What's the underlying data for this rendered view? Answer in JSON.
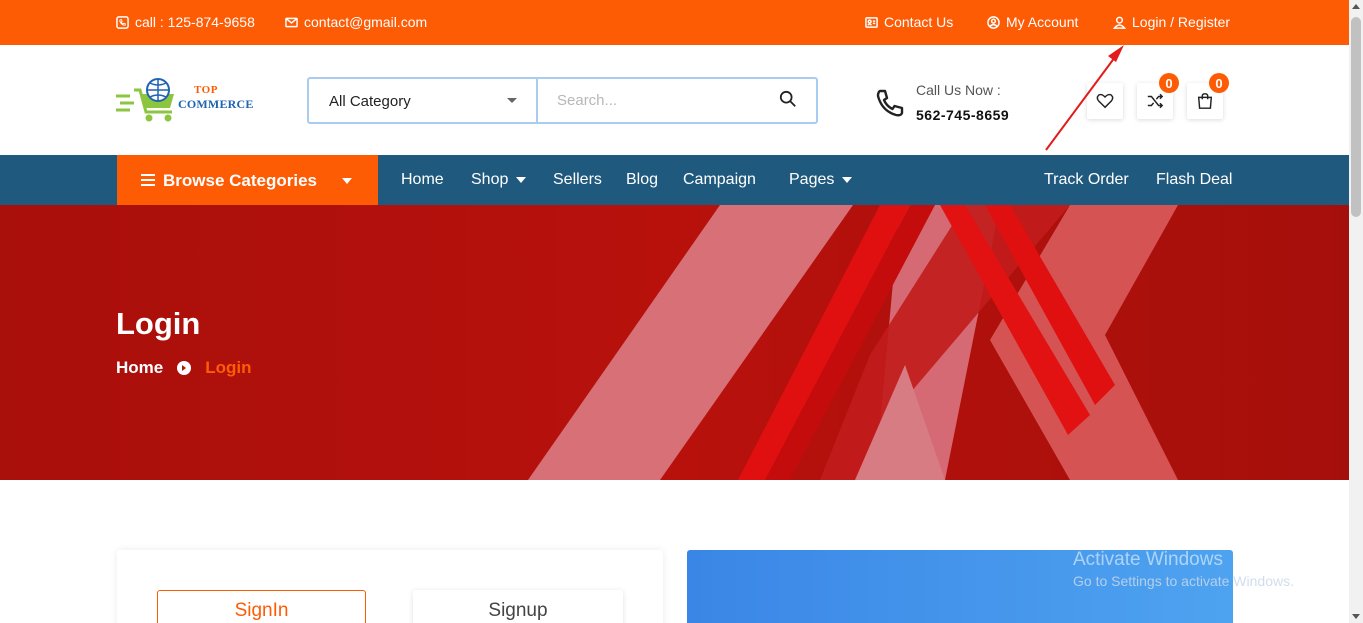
{
  "topbar": {
    "phone_icon": "phone-icon",
    "phone": "call : 125-874-9658",
    "email_icon": "envelope-icon",
    "email": "contact@gmail.com",
    "contact_us": "Contact Us",
    "my_account": "My Account",
    "login_register": "Login / Register"
  },
  "header": {
    "logo_top": "TOP",
    "logo_bottom": "COMMERCE",
    "category_selected": "All Category",
    "search_placeholder": "Search...",
    "call_label": "Call Us Now :",
    "call_number": "562-745-8659",
    "compare_count": "0",
    "cart_count": "0"
  },
  "nav": {
    "browse": "Browse Categories",
    "links": [
      "Home",
      "Shop",
      "Sellers",
      "Blog",
      "Campaign",
      "Pages"
    ],
    "track_order": "Track Order",
    "flash_deal": "Flash Deal"
  },
  "banner": {
    "title": "Login",
    "crumb_home": "Home",
    "crumb_current": "Login"
  },
  "auth": {
    "signin": "SignIn",
    "signup": "Signup"
  },
  "watermark": {
    "line1": "Activate Windows",
    "line2": "Go to Settings to activate Windows."
  },
  "colors": {
    "accent": "#fe5b05",
    "nav": "#1f5a7e",
    "banner": "#b3110c",
    "annotation_arrow": "#e31b1b"
  }
}
